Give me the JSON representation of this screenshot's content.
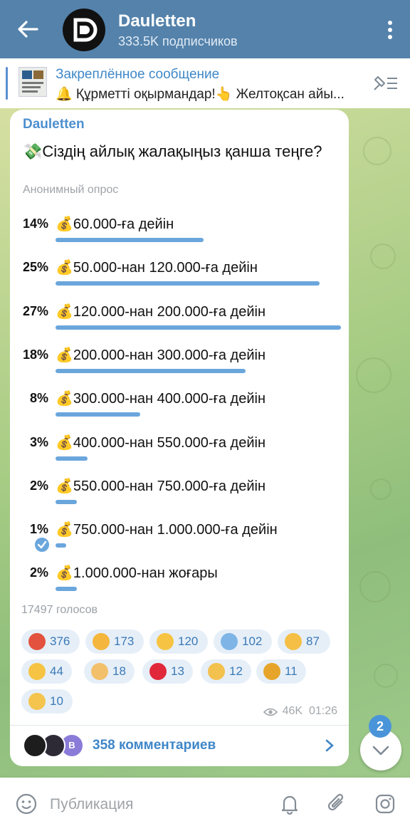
{
  "header": {
    "title": "Dauletten",
    "subtitle": "333.5K подписчиков"
  },
  "pinned": {
    "title": "Закреплённое сообщение",
    "text": "🔔 Құрметті оқырмандар!👆 Желтоқсан айы..."
  },
  "post": {
    "channel": "Dauletten",
    "question": "💸Сіздің айлық жалақыңыз қанша теңге?",
    "poll_type": "Анонимный опрос",
    "options": [
      {
        "pct": "14%",
        "value": 14,
        "label": "💰60.000-ға дейін"
      },
      {
        "pct": "25%",
        "value": 25,
        "label": "💰50.000-нан 120.000-ға дейін"
      },
      {
        "pct": "27%",
        "value": 27,
        "label": "💰120.000-нан 200.000-ға дейін"
      },
      {
        "pct": "18%",
        "value": 18,
        "label": "💰200.000-нан 300.000-ға дейін"
      },
      {
        "pct": "8%",
        "value": 8,
        "label": "💰300.000-нан 400.000-ға дейін"
      },
      {
        "pct": "3%",
        "value": 3,
        "label": "💰400.000-нан 550.000-ға дейін"
      },
      {
        "pct": "2%",
        "value": 2,
        "label": "💰550.000-нан 750.000-ға дейін"
      },
      {
        "pct": "1%",
        "value": 1,
        "label": "💰750.000-нан 1.000.000-ға дейін",
        "chosen": true
      },
      {
        "pct": "2%",
        "value": 2,
        "label": "💰1.000.000-нан жоғары"
      }
    ],
    "votes": "17497 голосов",
    "reactions": [
      {
        "emoji": "angry-face",
        "count": "376",
        "color": "#e2523e"
      },
      {
        "emoji": "thinking-face",
        "count": "173",
        "color": "#f4b63c"
      },
      {
        "emoji": "thumbs-up",
        "count": "120",
        "color": "#f6c343"
      },
      {
        "emoji": "screaming-face",
        "count": "102",
        "color": "#7fb5e6"
      },
      {
        "emoji": "crying-face",
        "count": "87",
        "color": "#f4bf44"
      },
      {
        "emoji": "grinning-face",
        "count": "44",
        "color": "#f6c343"
      },
      {
        "emoji": "folded-hands",
        "count": "18",
        "color": "#f2c06a"
      },
      {
        "emoji": "red-heart",
        "count": "13",
        "color": "#e0283a"
      },
      {
        "emoji": "clapping-hands",
        "count": "12",
        "color": "#f3c14e"
      },
      {
        "emoji": "trophy",
        "count": "11",
        "color": "#e6a52a"
      },
      {
        "emoji": "ok-hand",
        "count": "10",
        "color": "#f4c44e"
      }
    ],
    "views": "46K",
    "time": "01:26",
    "comments": "358 комментариев",
    "comment_avatar_letter": "B"
  },
  "fab": {
    "badge": "2"
  },
  "composer": {
    "placeholder": "Публикация"
  },
  "colors": {
    "header": "#5482ab",
    "accent": "#4c8fcf",
    "bar": "#6aa6dc"
  }
}
